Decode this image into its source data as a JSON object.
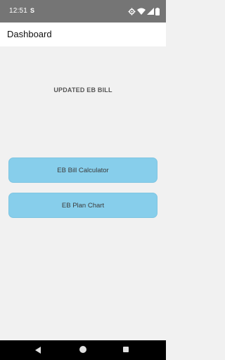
{
  "status_bar": {
    "time": "12:51",
    "sim_icon": "S",
    "icons": [
      "gear-icon",
      "wifi-icon",
      "signal-icon",
      "battery-icon"
    ]
  },
  "app_bar": {
    "title": "Dashboard"
  },
  "main": {
    "heading": "UPDATED EB BILL",
    "buttons": {
      "calculator": "EB Bill Calculator",
      "plan_chart": "EB Plan Chart"
    }
  },
  "colors": {
    "status_bar": "#757575",
    "button": "#87ceeb",
    "background": "#f1f1f1"
  }
}
